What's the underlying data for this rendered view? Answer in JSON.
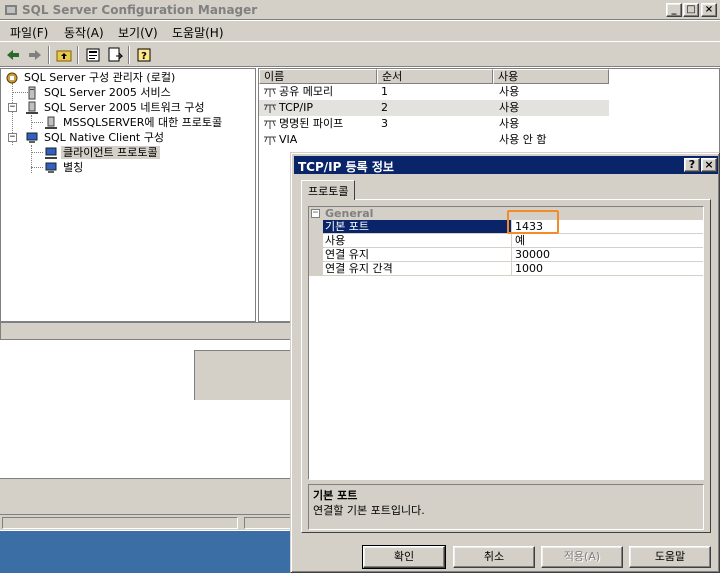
{
  "window": {
    "title": "SQL Server Configuration Manager",
    "min_btn": "_",
    "max_btn": "□",
    "close_btn": "×"
  },
  "menu": [
    "파일(F)",
    "동작(A)",
    "보기(V)",
    "도움말(H)"
  ],
  "toolbar": {
    "icons": [
      "back-arrow-icon",
      "forward-arrow-icon",
      "up-folder-icon",
      "properties-icon",
      "export-list-icon",
      "help-icon"
    ]
  },
  "tree": {
    "items": [
      {
        "label": "SQL Server 구성 관리자 (로컬)",
        "icon": "config-manager-icon"
      },
      {
        "label": "SQL Server 2005 서비스",
        "icon": "services-icon"
      },
      {
        "label": "SQL Server 2005 네트워크 구성",
        "icon": "network-config-icon",
        "expander": "−"
      },
      {
        "label": "MSSQLSERVER에 대한 프로토콜",
        "icon": "protocols-icon"
      },
      {
        "label": "SQL Native Client 구성",
        "icon": "native-client-icon",
        "expander": "−"
      },
      {
        "label": "클라이언트 프로토콜",
        "icon": "client-protocols-icon"
      },
      {
        "label": "별칭",
        "icon": "aliases-icon"
      }
    ]
  },
  "list": {
    "columns": [
      "이름",
      "순서",
      "사용"
    ],
    "rows": [
      {
        "name": "공유 메모리",
        "order": "1",
        "enabled": "사용"
      },
      {
        "name": "TCP/IP",
        "order": "2",
        "enabled": "사용"
      },
      {
        "name": "명명된 파이프",
        "order": "3",
        "enabled": "사용"
      },
      {
        "name": "VIA",
        "order": "",
        "enabled": "사용 안 함"
      }
    ]
  },
  "dialog": {
    "title": "TCP/IP 등록 정보",
    "help_btn": "?",
    "close_btn": "×",
    "tab": "프로토콜",
    "category": "General",
    "category_expander": "−",
    "properties": [
      {
        "name": "기본 포트",
        "value": "1433"
      },
      {
        "name": "사용",
        "value": "예"
      },
      {
        "name": "연결 유지",
        "value": "30000"
      },
      {
        "name": "연결 유지 간격",
        "value": "1000"
      }
    ],
    "description_title": "기본 포트",
    "description_text": "연결할 기본 포트입니다.",
    "buttons": {
      "ok": "확인",
      "cancel": "취소",
      "apply": "적용(A)",
      "help": "도움말"
    }
  }
}
